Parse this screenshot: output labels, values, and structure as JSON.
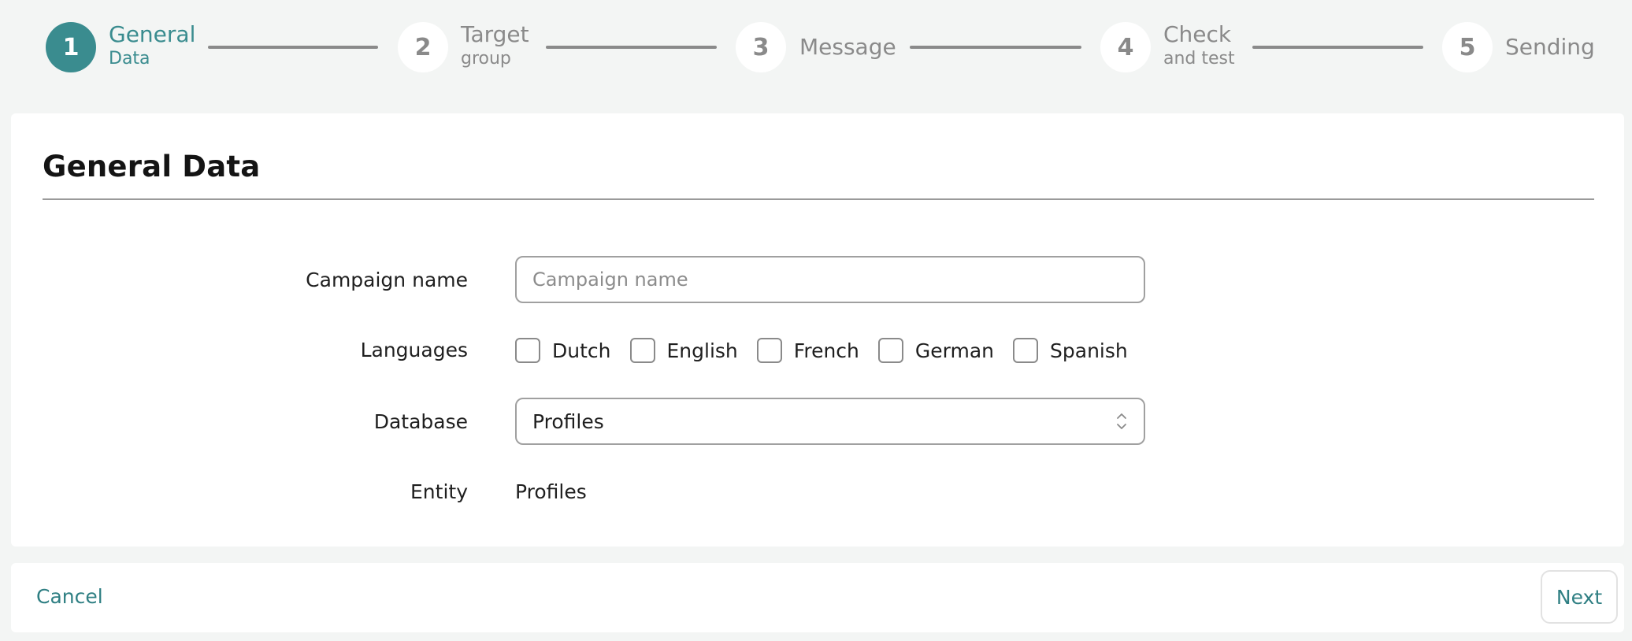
{
  "stepper": {
    "steps": [
      {
        "number": "1",
        "label": "General",
        "sublabel": "Data",
        "active": true
      },
      {
        "number": "2",
        "label": "Target",
        "sublabel": "group",
        "active": false
      },
      {
        "number": "3",
        "label": "Message",
        "sublabel": "",
        "active": false
      },
      {
        "number": "4",
        "label": "Check",
        "sublabel": "and test",
        "active": false
      },
      {
        "number": "5",
        "label": "Sending",
        "sublabel": "",
        "active": false
      }
    ]
  },
  "card": {
    "title": "General Data"
  },
  "form": {
    "campaign_name_label": "Campaign name",
    "campaign_name_placeholder": "Campaign name",
    "campaign_name_value": "",
    "languages_label": "Languages",
    "languages": [
      {
        "label": "Dutch",
        "checked": false
      },
      {
        "label": "English",
        "checked": false
      },
      {
        "label": "French",
        "checked": false
      },
      {
        "label": "German",
        "checked": false
      },
      {
        "label": "Spanish",
        "checked": false
      }
    ],
    "database_label": "Database",
    "database_value": "Profiles",
    "entity_label": "Entity",
    "entity_value": "Profiles"
  },
  "footer": {
    "cancel_label": "Cancel",
    "next_label": "Next"
  },
  "colors": {
    "accent": "#3a8c8f",
    "link": "#2f7f83",
    "inactive": "#8a8a8a",
    "background": "#f3f5f4"
  }
}
